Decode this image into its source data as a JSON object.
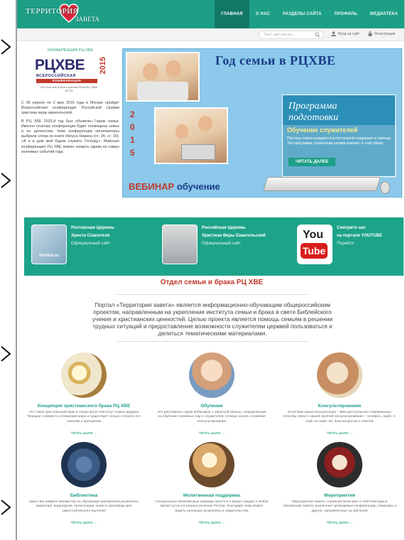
{
  "header": {
    "logo_word1": "ТЕРРИТОРИЯ",
    "logo_word2": "ЗАВЕТА",
    "nav": [
      "ГЛАВНАЯ",
      "О НАС",
      "РАЗДЕЛЫ САЙТА",
      "ПРОФИЛЬ",
      "МЕДИАТЕКА"
    ]
  },
  "subbar": {
    "search_placeholder": "Текст для поиска...",
    "login": "Вход на сайт",
    "register": "Регистрация"
  },
  "sidebar": {
    "title": "КОНФЕРЕНЦИЯ РЦ ХВЕ",
    "logo_big": "РЦХВЕ",
    "logo_year": "2015",
    "logo_sub1": "ВСЕРОССИЙСКАЯ",
    "logo_sub2": "КОНФЕРЕНЦИЯ",
    "logo_quote": "«Я и дом мой будем служить Господу» (Нав. 24:15)",
    "p1": "С 30 апреля по 2 мая 2015 года в Москве пройдет Всероссийская конференция Российской Церкви христиан веры евангельской.",
    "p2": "В РЦ ХВЕ 2015-й год был объявлен Годом семьи. Именно поэтому конференция будет посвящена семье и ее ценностям, тема конференции организаторы выбрали слова из книги Иисуса Навина (гл. 24, ст. 15): «А я и дом мой будем служить Господу». Майскую конференцию РЦ ХВЕ можно назвать одним из самых значимых событий года."
  },
  "banner": {
    "title": "Год семьи в РЦХВЕ",
    "year_digits": [
      "2",
      "0",
      "1",
      "5"
    ],
    "webinar_1": "ВЕБИНАР",
    "webinar_2": "обучение",
    "program_title": "Программа подготовки",
    "overlay_title": "Обучение служителей",
    "overlay_text": "Пасторы семьи нуждаются в постоянной поддержке и помощи. Эта программа служителям церкви поможет в этой сфере",
    "read_more": "ЧИТАТЬ ДАЛЕЕ"
  },
  "strip": [
    {
      "title1": "Ростовская Церковь",
      "title2": "Христа Спасителя",
      "link": "Официальный сайт",
      "img_label": "hristos.ru"
    },
    {
      "title1": "Российская Церковь",
      "title2": "Христиан Веры Евангельской",
      "link": "Официальный сайт"
    },
    {
      "title1": "Смотрите нас",
      "title2": "на портале YOUTUBE",
      "link": "Перейти",
      "yt_you": "You",
      "yt_tube": "Tube"
    }
  ],
  "section": {
    "title": "Отдел семьи и брака РЦ ХВЕ",
    "intro": "Портал «Территория завета» является информационно-обучающим общероссийским проектом, направленным на укрепление института семьи и брака в свете Библейского учения и христианских ценностей. Целью проекта является помощь семьям в решении трудных ситуаций и предоставление возможности служителям церквей пользоваться и делиться тематическими материалами."
  },
  "features": [
    {
      "title": "Концепция христианского брака РЦ ХВЕ",
      "desc": "Что такое христианский брак в глазах Бога? Институт семьи задуман Творцом с момента сотворения мира и существует только согласно его законам и принципам",
      "more": "Читать далее ..."
    },
    {
      "title": "Обучение",
      "desc": "Это регулярные серии вебинаров с обратной связью, направленные на обучение семейных пар и служителей, готовых начать служение консультирования",
      "more": "Читать далее ..."
    },
    {
      "title": "Консультирование",
      "desc": "Если Вам нужна консультация – Вам доступны все современные способы связи с нашей группой консультирования – телефон, скайп, e-mail, он-лайн чат, база вопросов и ответов",
      "more": "Читать далее ..."
    },
    {
      "title": "Библиотека",
      "desc": "Здесь Вы найдете множество не обучающих материалов различного характера: видеоуроки, презентации, книги и проповеди для самостоятельного изучения",
      "more": "Читать далее ..."
    },
    {
      "title": "Молитвенная поддержка",
      "desc": "Специальные молитвенные команды молятся о ваших нуждах в любое время суток и в разных регионах России, благодаря чему можно видеть реальные результаты и свидетельства",
      "more": "Читать далее ..."
    },
    {
      "title": "Мероприятия",
      "desc": "Мероприятия нашего служения включают в себя ежегодные обновления завета, различные проводимые конференции, семинары и другие, направленные на обучение",
      "more": "Читать далее ..."
    }
  ]
}
